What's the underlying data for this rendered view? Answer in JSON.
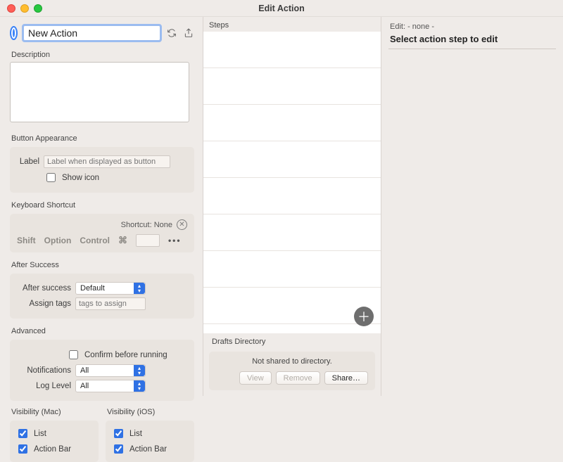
{
  "window": {
    "title": "Edit Action"
  },
  "action": {
    "name": "New Action",
    "description_label": "Description",
    "description": ""
  },
  "button_appearance": {
    "header": "Button Appearance",
    "label_label": "Label",
    "label_placeholder": "Label when displayed as button",
    "label_value": "",
    "show_icon_label": "Show icon",
    "show_icon": false
  },
  "keyboard_shortcut": {
    "header": "Keyboard Shortcut",
    "shortcut_text": "Shortcut: None",
    "mods": {
      "shift": "Shift",
      "option": "Option",
      "control": "Control",
      "command": "⌘"
    },
    "key_value": ""
  },
  "after_success": {
    "header": "After Success",
    "after_label": "After success",
    "after_value": "Default",
    "tags_label": "Assign tags",
    "tags_placeholder": "tags to assign",
    "tags_value": ""
  },
  "advanced": {
    "header": "Advanced",
    "confirm_label": "Confirm before running",
    "confirm": false,
    "notifications_label": "Notifications",
    "notifications_value": "All",
    "loglevel_label": "Log Level",
    "loglevel_value": "All"
  },
  "visibility": {
    "mac": {
      "header": "Visibility (Mac)",
      "list_label": "List",
      "list": true,
      "bar_label": "Action Bar",
      "bar": true
    },
    "ios": {
      "header": "Visibility (iOS)",
      "list_label": "List",
      "list": true,
      "bar_label": "Action Bar",
      "bar": true
    }
  },
  "steps": {
    "header": "Steps"
  },
  "drafts_directory": {
    "header": "Drafts Directory",
    "status": "Not shared to directory.",
    "view_label": "View",
    "remove_label": "Remove",
    "share_label": "Share…"
  },
  "editor": {
    "header": "Edit: - none -",
    "message": "Select action step to edit"
  }
}
